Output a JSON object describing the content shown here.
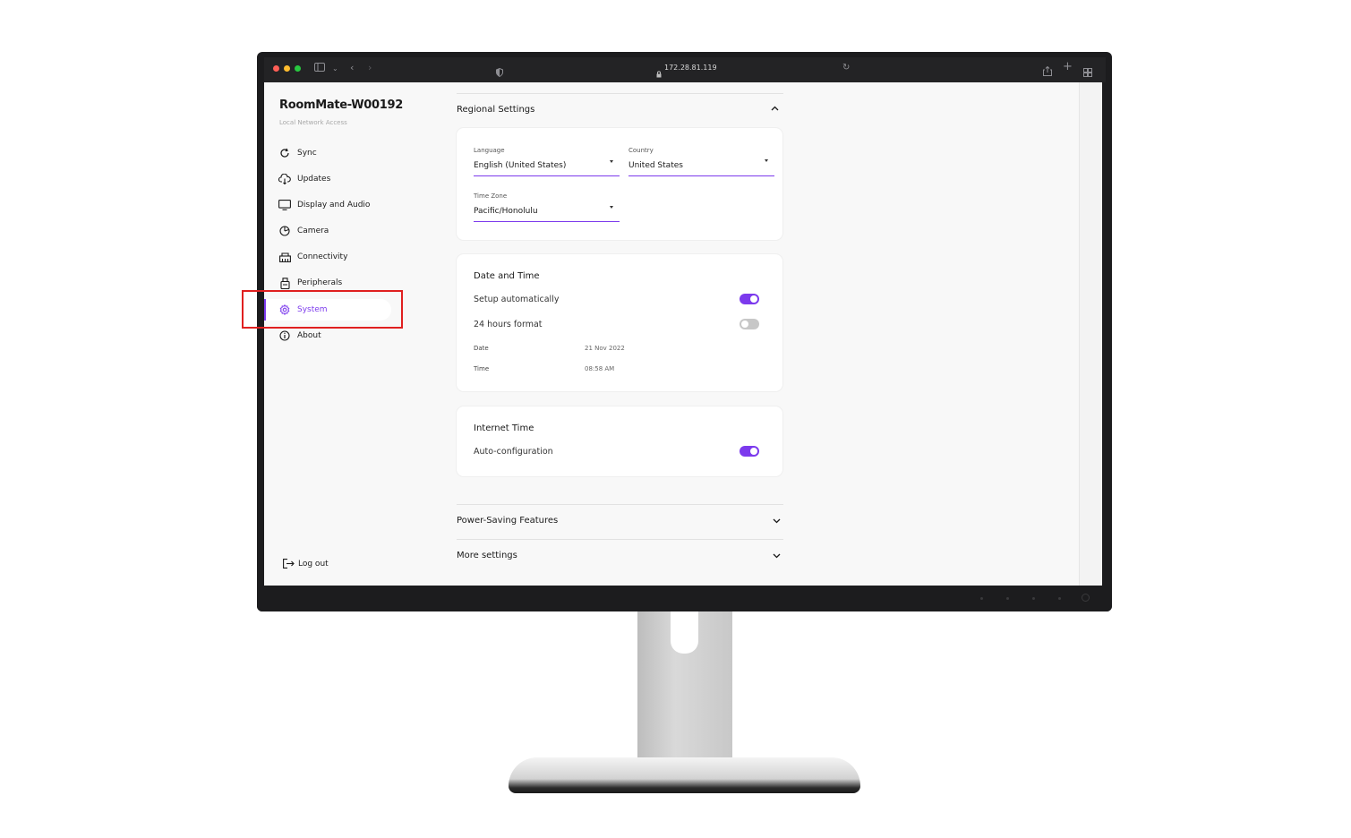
{
  "browser": {
    "url": "172.28.81.119"
  },
  "sidebar": {
    "device_name": "RoomMate-W00192",
    "subtitle": "Local Network Access",
    "items": [
      {
        "label": "Sync",
        "icon": "sync-icon"
      },
      {
        "label": "Updates",
        "icon": "cloud-update-icon"
      },
      {
        "label": "Display and Audio",
        "icon": "monitor-icon"
      },
      {
        "label": "Camera",
        "icon": "camera-icon"
      },
      {
        "label": "Connectivity",
        "icon": "network-icon"
      },
      {
        "label": "Peripherals",
        "icon": "peripheral-icon"
      },
      {
        "label": "System",
        "icon": "gear-icon",
        "active": true
      },
      {
        "label": "About",
        "icon": "info-icon"
      }
    ],
    "logout_label": "Log out"
  },
  "regional": {
    "title": "Regional Settings",
    "language_label": "Language",
    "language_value": "English (United States)",
    "country_label": "Country",
    "country_value": "United States",
    "timezone_label": "Time Zone",
    "timezone_value": "Pacific/Honolulu"
  },
  "date_time": {
    "title": "Date and Time",
    "setup_auto_label": "Setup automatically",
    "setup_auto_on": true,
    "format24_label": "24 hours format",
    "format24_on": false,
    "date_label": "Date",
    "date_value": "21 Nov 2022",
    "time_label": "Time",
    "time_value": "08:58 AM"
  },
  "internet_time": {
    "title": "Internet Time",
    "auto_config_label": "Auto-configuration",
    "auto_config_on": true
  },
  "power_saving": {
    "title": "Power-Saving Features"
  },
  "more_settings": {
    "title": "More settings"
  },
  "colors": {
    "accent": "#7c3aed",
    "highlight": "#e02020"
  }
}
